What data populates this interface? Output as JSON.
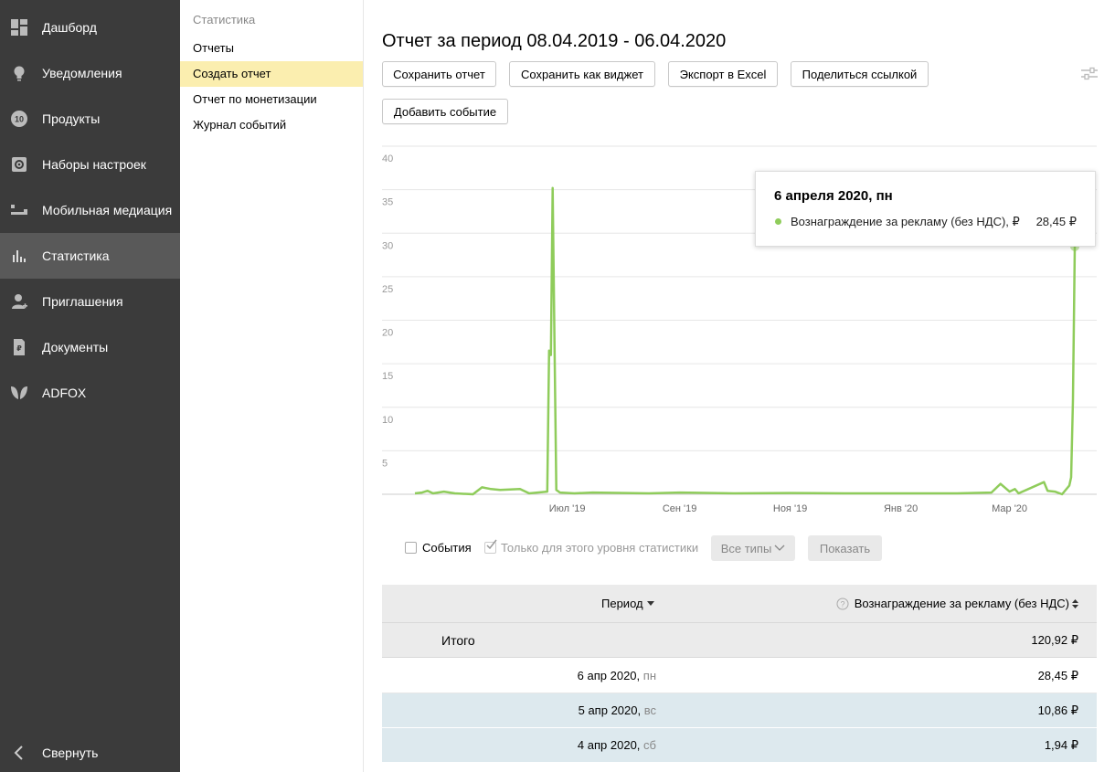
{
  "sidebar": {
    "items": [
      {
        "label": "Дашборд",
        "icon": "dashboard-icon"
      },
      {
        "label": "Уведомления",
        "icon": "lightbulb-icon"
      },
      {
        "label": "Продукты",
        "icon": "products-icon",
        "badge": "10"
      },
      {
        "label": "Наборы настроек",
        "icon": "settings-icon"
      },
      {
        "label": "Мобильная медиация",
        "icon": "mediation-icon"
      },
      {
        "label": "Статистика",
        "icon": "bar-chart-icon",
        "active": true
      },
      {
        "label": "Приглашения",
        "icon": "invite-icon"
      },
      {
        "label": "Документы",
        "icon": "document-icon"
      },
      {
        "label": "ADFOX",
        "icon": "adfox-icon"
      }
    ],
    "collapse_label": "Свернуть"
  },
  "subnav": {
    "title": "Статистика",
    "items": [
      "Отчеты",
      "Создать отчет",
      "Отчет по монетизации",
      "Журнал событий"
    ],
    "active_index": 1
  },
  "main": {
    "title": "Отчет за период 08.04.2019 - 06.04.2020",
    "buttons": {
      "save_report": "Сохранить отчет",
      "save_widget": "Сохранить как виджет",
      "export_excel": "Экспорт в Excel",
      "share_link": "Поделиться ссылкой",
      "add_event": "Добавить событие"
    }
  },
  "tooltip": {
    "date": "6 апреля 2020, пн",
    "series": "Вознаграждение за рекламу (без НДС), ₽",
    "value": "28,45 ₽"
  },
  "filters": {
    "events_label": "События",
    "only_level_label": "Только для этого уровня статистики",
    "all_types_label": "Все типы",
    "show_label": "Показать"
  },
  "table": {
    "col_period": "Период",
    "col_reward": "Вознаграждение за рекламу (без НДС)",
    "total_label": "Итого",
    "total_value": "120,92 ₽",
    "rows": [
      {
        "date": "6 апр 2020,",
        "weekday": "пн",
        "value": "28,45 ₽"
      },
      {
        "date": "5 апр 2020,",
        "weekday": "вс",
        "value": "10,86 ₽"
      },
      {
        "date": "4 апр 2020,",
        "weekday": "сб",
        "value": "1,94 ₽"
      }
    ]
  },
  "colors": {
    "sidebar_bg": "#3b3b3b",
    "sidebar_active": "#595959",
    "subnav_active": "#fbeeaf",
    "series": "#8fcc5b",
    "row_highlight": "#dde9ee"
  },
  "chart_data": {
    "type": "line",
    "ylim": [
      0,
      40
    ],
    "yticks": [
      5,
      10,
      15,
      20,
      25,
      30,
      35,
      40
    ],
    "xticks": [
      {
        "label": "Июл '19",
        "x": "2019-07-01"
      },
      {
        "label": "Сен '19",
        "x": "2019-09-01"
      },
      {
        "label": "Ноя '19",
        "x": "2019-11-01"
      },
      {
        "label": "Янв '20",
        "x": "2020-01-01"
      },
      {
        "label": "Мар '20",
        "x": "2020-03-01"
      }
    ],
    "xlim": [
      "2019-04-08",
      "2020-04-06"
    ],
    "series": [
      {
        "name": "Вознаграждение за рекламу (без НДС)",
        "color": "#8fcc5b",
        "points": [
          [
            "2019-04-08",
            0.1
          ],
          [
            "2019-04-12",
            0.2
          ],
          [
            "2019-04-15",
            0.4
          ],
          [
            "2019-04-18",
            0.1
          ],
          [
            "2019-04-24",
            0.3
          ],
          [
            "2019-04-30",
            0.1
          ],
          [
            "2019-05-10",
            0.0
          ],
          [
            "2019-05-15",
            0.8
          ],
          [
            "2019-05-20",
            0.6
          ],
          [
            "2019-05-25",
            0.5
          ],
          [
            "2019-06-05",
            0.6
          ],
          [
            "2019-06-10",
            0.1
          ],
          [
            "2019-06-20",
            0.3
          ],
          [
            "2019-06-21",
            16.5
          ],
          [
            "2019-06-22",
            16.0
          ],
          [
            "2019-06-23",
            35.2
          ],
          [
            "2019-06-24",
            17.5
          ],
          [
            "2019-06-25",
            0.5
          ],
          [
            "2019-06-27",
            0.2
          ],
          [
            "2019-07-05",
            0.1
          ],
          [
            "2019-07-15",
            0.2
          ],
          [
            "2019-08-15",
            0.1
          ],
          [
            "2019-09-01",
            0.2
          ],
          [
            "2019-10-01",
            0.1
          ],
          [
            "2019-11-01",
            0.15
          ],
          [
            "2019-12-01",
            0.1
          ],
          [
            "2020-01-01",
            0.1
          ],
          [
            "2020-02-01",
            0.1
          ],
          [
            "2020-02-20",
            0.2
          ],
          [
            "2020-02-25",
            1.2
          ],
          [
            "2020-03-01",
            0.3
          ],
          [
            "2020-03-04",
            0.6
          ],
          [
            "2020-03-06",
            0.1
          ],
          [
            "2020-03-20",
            1.4
          ],
          [
            "2020-03-22",
            0.4
          ],
          [
            "2020-03-26",
            0.3
          ],
          [
            "2020-03-30",
            0.0
          ],
          [
            "2020-04-03",
            1.0
          ],
          [
            "2020-04-04",
            1.94
          ],
          [
            "2020-04-05",
            10.86
          ],
          [
            "2020-04-06",
            28.45
          ]
        ]
      }
    ]
  }
}
